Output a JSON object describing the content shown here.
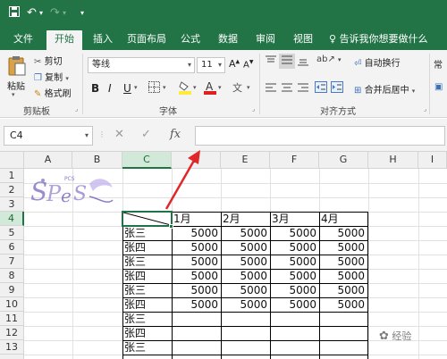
{
  "colors": {
    "brand_green": "#227447",
    "select_green": "#217346",
    "arrow_red": "#e0282b"
  },
  "title_bar": {
    "icons": [
      "save-icon",
      "undo-icon",
      "redo-icon",
      "customize-icon"
    ]
  },
  "tabs": [
    {
      "label": "文件",
      "active": false
    },
    {
      "label": "开始",
      "active": true
    },
    {
      "label": "插入",
      "active": false
    },
    {
      "label": "页面布局",
      "active": false
    },
    {
      "label": "公式",
      "active": false
    },
    {
      "label": "数据",
      "active": false
    },
    {
      "label": "审阅",
      "active": false
    },
    {
      "label": "视图",
      "active": false
    }
  ],
  "tell_me": "告诉我你想要做什么",
  "ribbon": {
    "clipboard": {
      "paste": "粘贴",
      "cut": "剪切",
      "copy": "复制",
      "format_painter": "格式刷",
      "label": "剪贴板"
    },
    "font": {
      "font_name": "等线",
      "font_size": "11",
      "bold": "B",
      "italic": "I",
      "underline": "U",
      "label": "字体"
    },
    "alignment": {
      "wrap": "自动换行",
      "merge": "合并后居中",
      "label": "对齐方式"
    },
    "number": {
      "format_partial": "常"
    }
  },
  "formula_bar": {
    "name_box": "C4",
    "fx": "fx",
    "cancel": "✕",
    "enter": "✓",
    "value": ""
  },
  "columns": [
    "A",
    "B",
    "C",
    "D",
    "E",
    "F",
    "G",
    "H",
    "I"
  ],
  "rows": [
    "1",
    "2",
    "3",
    "4",
    "5",
    "6",
    "7",
    "8",
    "9",
    "10",
    "11",
    "12",
    "13"
  ],
  "table": {
    "months": [
      "1月",
      "2月",
      "3月",
      "4月"
    ],
    "names": [
      "张三",
      "张四",
      "张三",
      "张四",
      "张三",
      "张四",
      "张三",
      "张四",
      "张三"
    ],
    "values": [
      [
        "5000",
        "5000",
        "5000",
        "5000"
      ],
      [
        "5000",
        "5000",
        "5000",
        "5000"
      ],
      [
        "5000",
        "5000",
        "5000",
        "5000"
      ],
      [
        "5000",
        "5000",
        "5000",
        "5000"
      ],
      [
        "5000",
        "5000",
        "5000",
        "5000"
      ],
      [
        "5000",
        "5000",
        "5000",
        "5000"
      ]
    ]
  },
  "watermark": "经验"
}
